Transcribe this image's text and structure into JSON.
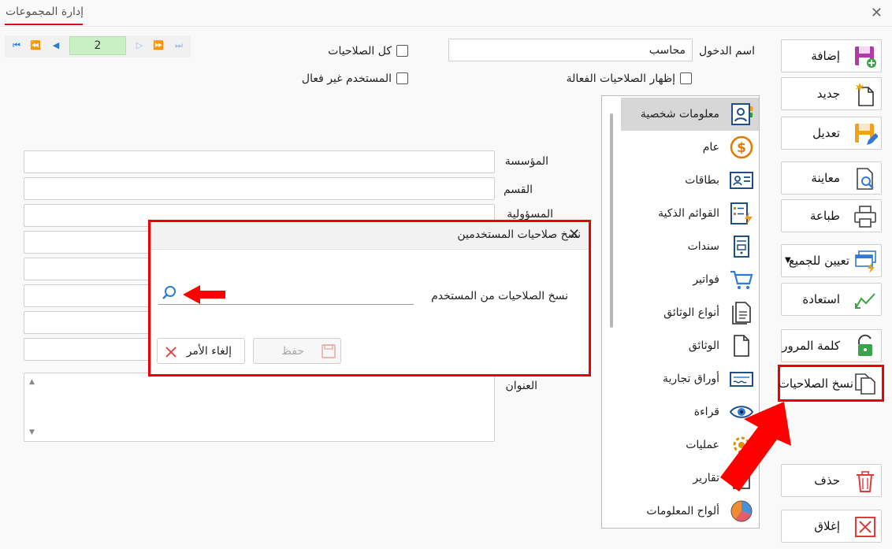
{
  "window": {
    "tab_title": "إدارة المجموعات",
    "close_glyph": "✕"
  },
  "nav": {
    "page": "2"
  },
  "form": {
    "login_label": "اسم الدخول",
    "login_value": "محاسب",
    "all_permissions": "كل الصلاحيات",
    "show_active_permissions": "إظهار الصلاحيات الفعالة",
    "inactive_user": "المستخدم غير فعال",
    "institution_label": "المؤسسة",
    "department_label": "القسم",
    "responsible_label": "المسؤولية",
    "address_label": "العنوان"
  },
  "categories": [
    {
      "label": "معلومات شخصية",
      "icon": "person-card-icon"
    },
    {
      "label": "عام",
      "icon": "dollar-coin-icon"
    },
    {
      "label": "بطاقات",
      "icon": "id-card-icon"
    },
    {
      "label": "القوائم الذكية",
      "icon": "smart-list-icon"
    },
    {
      "label": "سندات",
      "icon": "voucher-icon"
    },
    {
      "label": "فواتير",
      "icon": "cart-icon"
    },
    {
      "label": "أنواع الوثائق",
      "icon": "document-types-icon"
    },
    {
      "label": "الوثائق",
      "icon": "document-icon"
    },
    {
      "label": "أوراق تجارية",
      "icon": "cheque-icon"
    },
    {
      "label": "قراءة",
      "icon": "eye-icon"
    },
    {
      "label": "عمليات",
      "icon": "operations-icon"
    },
    {
      "label": "تقارير",
      "icon": "report-icon"
    },
    {
      "label": "ألواح المعلومات",
      "icon": "pie-chart-icon"
    }
  ],
  "toolbar": {
    "add": "إضافة",
    "new": "جديد",
    "edit": "تعديل",
    "preview": "معاينة",
    "print": "طباعة",
    "assign_all": "تعيين للجميع",
    "restore": "استعادة",
    "password": "كلمة المرور",
    "copy_permissions": "نسخ الصلاحيات",
    "delete": "حذف",
    "close": "إغلاق"
  },
  "dialog": {
    "title": "نسخ صلاحيات المستخدمين",
    "copy_from_label": "نسخ الصلاحيات من المستخدم",
    "search_value": "",
    "save": "حفظ",
    "cancel": "إلغاء الأمر"
  },
  "colors": {
    "highlight": "#e00000",
    "accent_blue": "#2d7bd6",
    "page_green": "#c9f0c4"
  }
}
